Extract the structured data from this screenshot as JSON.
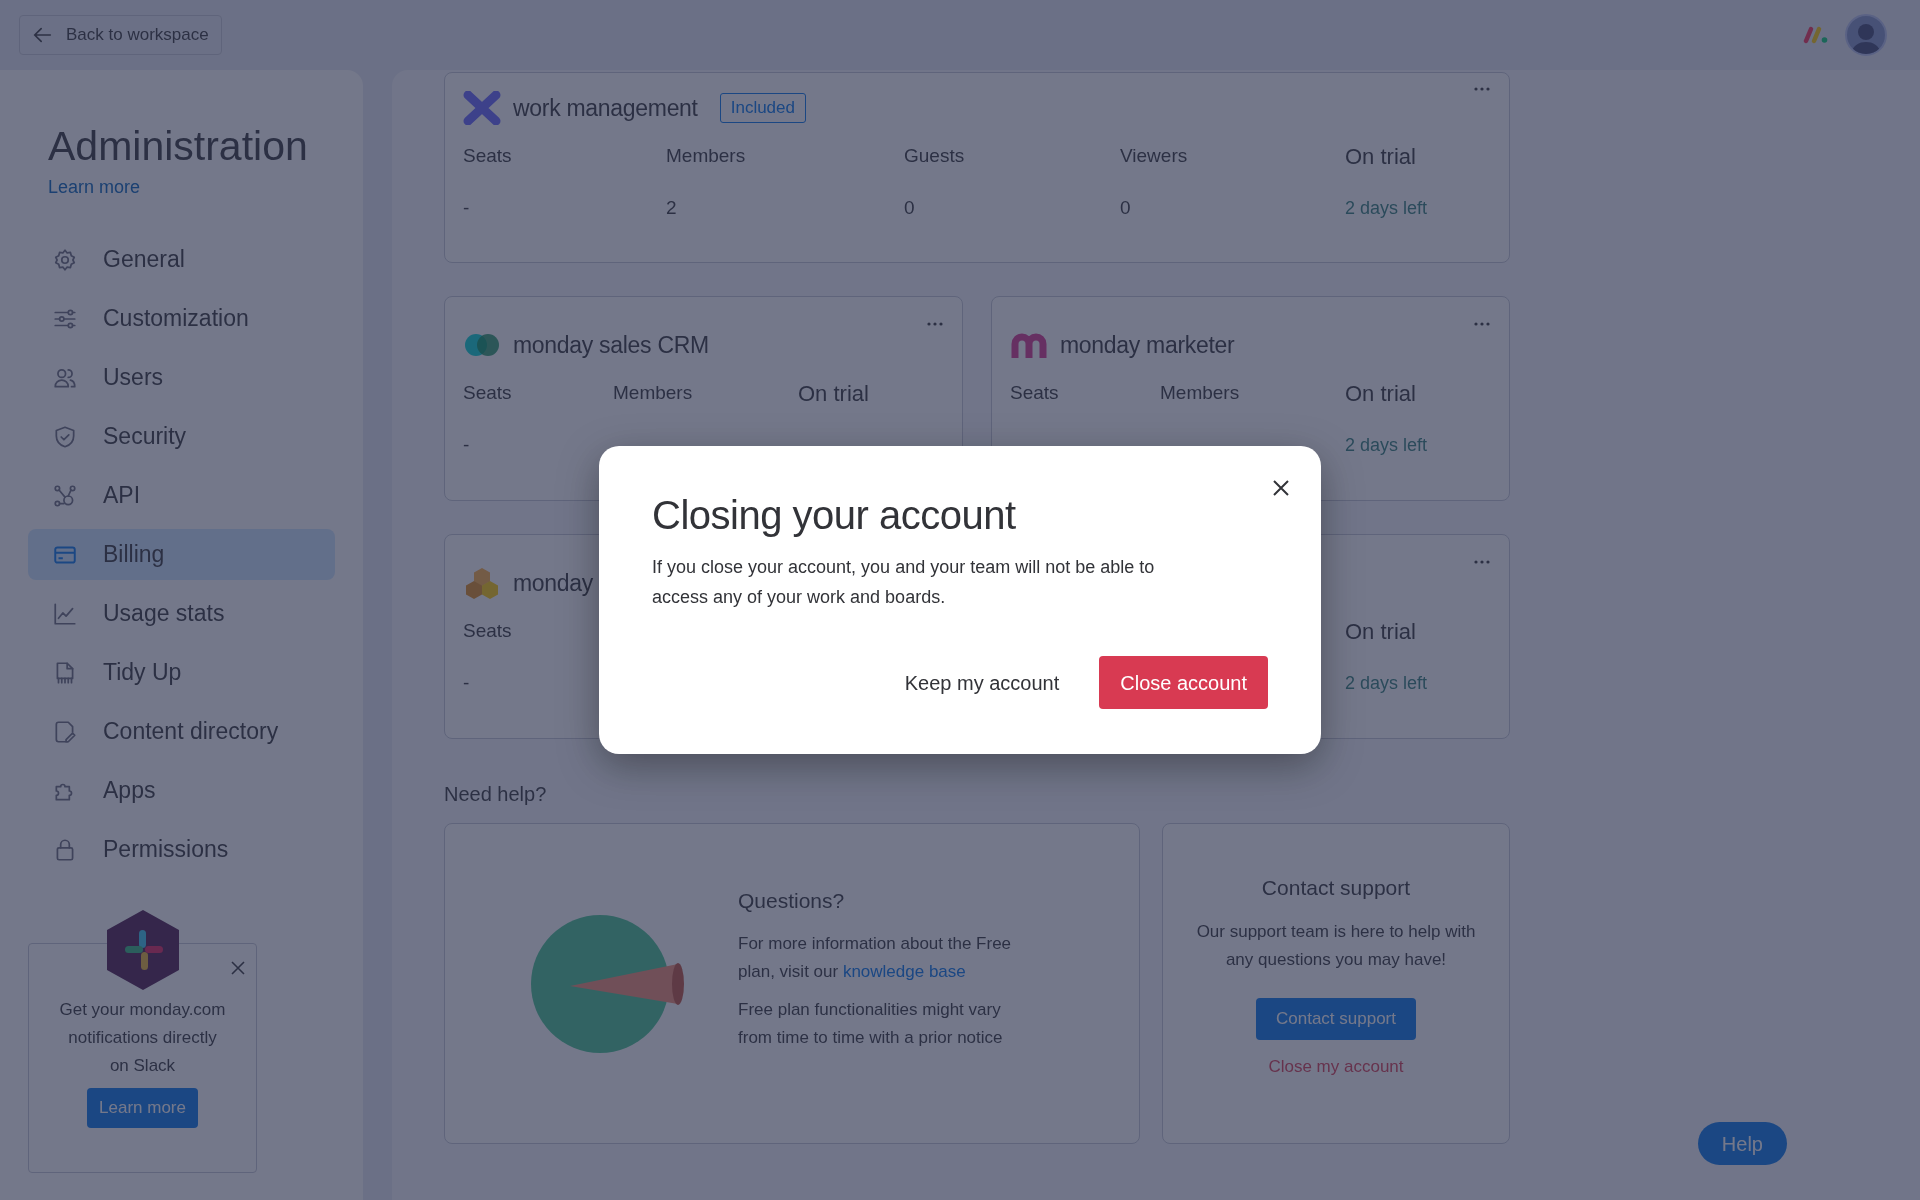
{
  "top_bar": {
    "back_button": "Back to workspace"
  },
  "sidebar": {
    "title": "Administration",
    "learn_more": "Learn more",
    "items": [
      {
        "label": "General",
        "selected": false
      },
      {
        "label": "Customization",
        "selected": false
      },
      {
        "label": "Users",
        "selected": false
      },
      {
        "label": "Security",
        "selected": false
      },
      {
        "label": "API",
        "selected": false
      },
      {
        "label": "Billing",
        "selected": true
      },
      {
        "label": "Usage stats",
        "selected": false
      },
      {
        "label": "Tidy Up",
        "selected": false
      },
      {
        "label": "Content directory",
        "selected": false
      },
      {
        "label": "Apps",
        "selected": false
      },
      {
        "label": "Permissions",
        "selected": false
      }
    ],
    "promo": {
      "text": "Get your monday.com notifications directly on Slack",
      "button": "Learn more"
    }
  },
  "products": [
    {
      "kind": "work",
      "name": "work management",
      "badge": "Included",
      "columns": [
        {
          "label": "Seats",
          "value": "-"
        },
        {
          "label": "Members",
          "value": "2"
        },
        {
          "label": "Guests",
          "value": "0"
        },
        {
          "label": "Viewers",
          "value": "0"
        }
      ],
      "status": "On trial",
      "status_detail": "2 days left"
    },
    {
      "kind": "crm",
      "name": "monday sales CRM",
      "columns": [
        {
          "label": "Seats",
          "value": "-"
        },
        {
          "label": "Members"
        }
      ],
      "status": "On trial"
    },
    {
      "kind": "marketer",
      "name": "monday marketer",
      "columns": [
        {
          "label": "Seats"
        },
        {
          "label": "Members"
        }
      ],
      "status": "On trial",
      "status_detail": "2 days left"
    },
    {
      "kind": "projects",
      "name": "monday",
      "columns": [
        {
          "label": "Seats",
          "value": "-"
        }
      ]
    },
    {
      "kind": "blank",
      "status": "On trial",
      "status_detail": "2 days left"
    }
  ],
  "help": {
    "heading": "Need help?",
    "questions": {
      "title": "Questions?",
      "text": "For more information about the Free plan, visit our ",
      "link": "knowledge base",
      "note": "Free plan functionalities might vary from time to time with a prior notice"
    },
    "contact": {
      "title": "Contact support",
      "text": "Our support team is here to help with any questions you may have!",
      "button": "Contact support",
      "link": "Close my account"
    }
  },
  "help_button": "Help",
  "modal": {
    "title": "Closing your account",
    "body": "If you close your account, you and your team will not be able to access any of your work and boards.",
    "secondary_button": "Keep my account",
    "primary_button": "Close account"
  }
}
